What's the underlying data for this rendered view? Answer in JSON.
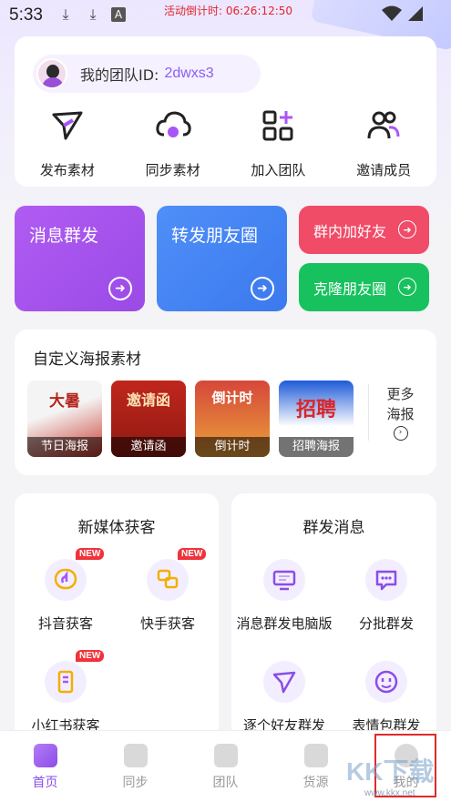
{
  "status_bar": {
    "time": "5:33",
    "countdown": "活动倒计时: 06:26:12:50"
  },
  "team": {
    "id_label": "我的团队ID:",
    "id_value": "2dwxs3",
    "actions": [
      {
        "label": "发布素材",
        "icon": "paper-plane-icon"
      },
      {
        "label": "同步素材",
        "icon": "cloud-sync-icon"
      },
      {
        "label": "加入团队",
        "icon": "grid-plus-icon"
      },
      {
        "label": "邀请成员",
        "icon": "users-icon"
      }
    ]
  },
  "tiles": {
    "mass_message": "消息群发",
    "moments_forward": "转发朋友圈",
    "group_add_friend": "群内加好友",
    "clone_moments": "克隆朋友圈"
  },
  "posters": {
    "title": "自定义海报素材",
    "items": [
      {
        "caption": "节日海报",
        "art_text": "大暑"
      },
      {
        "caption": "邀请函",
        "art_text": "邀请函"
      },
      {
        "caption": "倒计时",
        "art_text": "倒计时"
      },
      {
        "caption": "招聘海报",
        "art_text": "招聘"
      }
    ],
    "more_line1": "更多",
    "more_line2": "海报"
  },
  "new_media": {
    "title": "新媒体获客",
    "badge": "NEW",
    "items": [
      {
        "label": "抖音获客",
        "icon": "douyin-icon"
      },
      {
        "label": "快手获客",
        "icon": "kuaishou-icon"
      },
      {
        "label": "小红书获客",
        "icon": "xiaohongshu-icon"
      }
    ]
  },
  "group_send": {
    "title": "群发消息",
    "items": [
      {
        "label": "消息群发电脑版",
        "icon": "monitor-icon"
      },
      {
        "label": "分批群发",
        "icon": "chat-bubble-icon"
      },
      {
        "label": "逐个好友群发",
        "icon": "send-icon"
      },
      {
        "label": "表情包群发",
        "icon": "smiley-icon"
      }
    ]
  },
  "bottom_nav": {
    "items": [
      {
        "label": "首页",
        "active": true
      },
      {
        "label": "同步",
        "active": false
      },
      {
        "label": "团队",
        "active": false
      },
      {
        "label": "货源",
        "active": false
      },
      {
        "label": "我的",
        "active": false
      }
    ]
  },
  "watermark": {
    "text": "KK下载",
    "url_text": "www.kkx.net"
  },
  "colors": {
    "accent": "#8b4de8",
    "purple_tile": "#a855f7",
    "blue_tile": "#3b82f6",
    "red_tile": "#f04b67",
    "green_tile": "#17c25e",
    "badge_red": "#f0333b"
  }
}
